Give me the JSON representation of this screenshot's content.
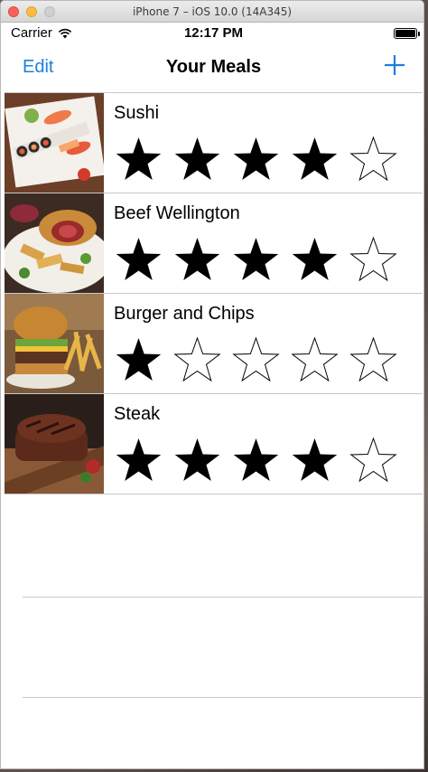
{
  "window": {
    "title": "iPhone 7 – iOS 10.0 (14A345)"
  },
  "status_bar": {
    "carrier": "Carrier",
    "time": "12:17 PM"
  },
  "navbar": {
    "edit_label": "Edit",
    "title": "Your Meals",
    "add_icon": "plus-icon"
  },
  "meals": [
    {
      "name": "Sushi",
      "rating": 4,
      "max_rating": 5
    },
    {
      "name": "Beef Wellington",
      "rating": 4,
      "max_rating": 5
    },
    {
      "name": "Burger and Chips",
      "rating": 1,
      "max_rating": 5
    },
    {
      "name": "Steak",
      "rating": 4,
      "max_rating": 5
    }
  ],
  "colors": {
    "accent": "#1a7fe0",
    "separator": "#c8c7cc"
  }
}
